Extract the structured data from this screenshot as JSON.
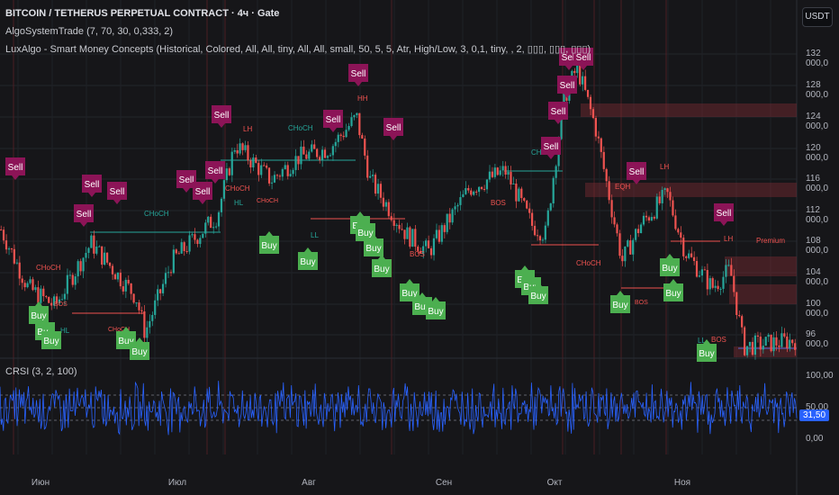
{
  "header": {
    "symbol_title": "BITCOIN / TETHERUS PERPETUAL CONTRACT · 4ч · Gate",
    "indicator_1": "AlgoSystemTrade (7, 70, 30, 0,333, 2)",
    "indicator_2": "LuxAlgo - Smart Money Concepts (Historical, Colored, All, All, tiny, All, All, small, 50, 5, 5, Atr, High/Low, 3, 0,1, tiny, , 2, ▯▯▯, ▯▯▯, ▯▯▯)",
    "currency_button": "USDT"
  },
  "crsi_pane": {
    "label": "CRSI (3, 2, 100)",
    "current_value": "31,50"
  },
  "colors": {
    "bg": "#161619",
    "up": "#26a69a",
    "down": "#ef5350",
    "sell": "#8c1457",
    "buy": "#4caf50",
    "crsi": "#2962ff"
  },
  "chart_data": {
    "type": "candlestick",
    "price_axis": {
      "ticks": [
        "132 000,0",
        "128 000,0",
        "124 000,0",
        "120 000,0",
        "116 000,0",
        "112 000,0",
        "108 000,0",
        "104 000,0",
        "100 000,0",
        "96 000,0"
      ],
      "range": [
        93000,
        135000
      ]
    },
    "crsi_axis": {
      "ticks": [
        "100,00",
        "50,00",
        "0,00"
      ],
      "levels": [
        70,
        50,
        30
      ]
    },
    "time_axis": [
      "Июн",
      "Июл",
      "Авг",
      "Сен",
      "Окт",
      "Ноя"
    ],
    "price_path": [
      [
        0,
        109450
      ],
      [
        30,
        102000
      ],
      [
        60,
        99600
      ],
      [
        100,
        107700
      ],
      [
        150,
        100800
      ],
      [
        160,
        96200
      ],
      [
        190,
        105400
      ],
      [
        240,
        111200
      ],
      [
        260,
        120400
      ],
      [
        300,
        115800
      ],
      [
        330,
        118700
      ],
      [
        365,
        119900
      ],
      [
        395,
        123900
      ],
      [
        410,
        115800
      ],
      [
        450,
        108900
      ],
      [
        475,
        106600
      ],
      [
        520,
        114700
      ],
      [
        560,
        117000
      ],
      [
        590,
        110000
      ],
      [
        605,
        108900
      ],
      [
        625,
        126200
      ],
      [
        640,
        130300
      ],
      [
        660,
        122800
      ],
      [
        690,
        105400
      ],
      [
        710,
        110000
      ],
      [
        740,
        114000
      ],
      [
        760,
        106600
      ],
      [
        790,
        102000
      ],
      [
        810,
        104300
      ],
      [
        825,
        94400
      ],
      [
        885,
        95300
      ]
    ],
    "signals": {
      "sell_label": "Sell",
      "buy_label": "Buy"
    },
    "structure_labels": [
      "CHoCH",
      "BOS",
      "LH",
      "HH",
      "HL",
      "LL",
      "EQH",
      "Premium"
    ]
  }
}
